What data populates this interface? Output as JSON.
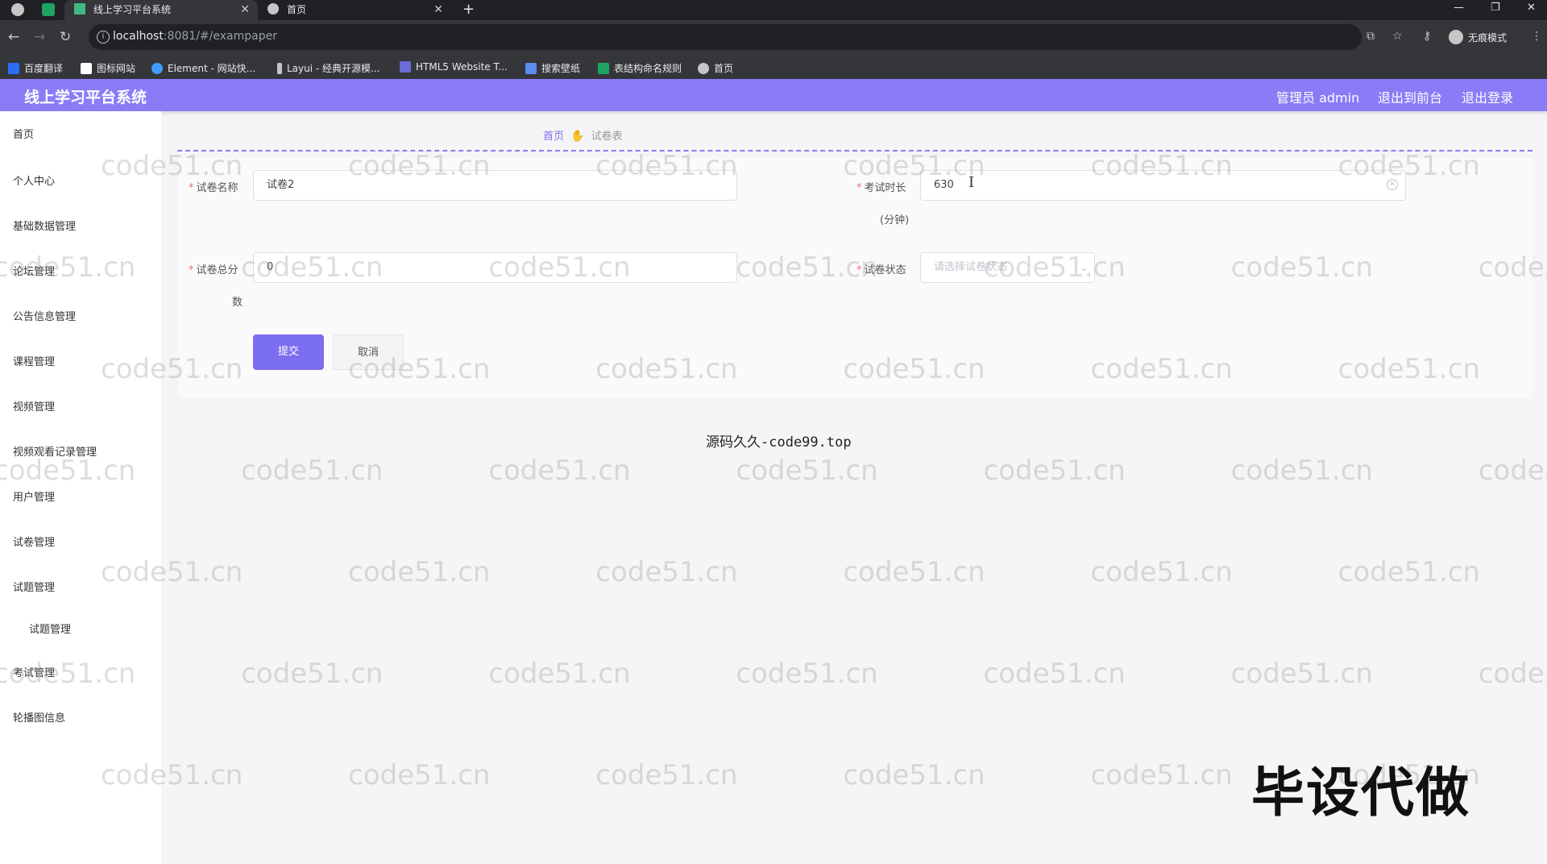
{
  "browser": {
    "tabs": [
      {
        "title": "线上学习平台系统",
        "active": true
      },
      {
        "title": "首页",
        "active": false
      }
    ],
    "new_tab": "+",
    "window_controls": [
      "—",
      "❐",
      "✕"
    ],
    "url_host": "localhost",
    "url_rest": ":8081/#/exampaper",
    "incognito_label": "无痕模式",
    "bookmarks": [
      {
        "label": "百度翻译",
        "color": "#2b6ef5"
      },
      {
        "label": "图标网站",
        "color": "#ffffff"
      },
      {
        "label": "Element - 网站快...",
        "color": "#409eff"
      },
      {
        "label": "Layui - 经典开源模...",
        "color": "#c4c7c5"
      },
      {
        "label": "HTML5 Website T...",
        "color": "#6b6bd6"
      },
      {
        "label": "搜索壁纸",
        "color": "#5b8def"
      },
      {
        "label": "表结构命名规则",
        "color": "#1fa463"
      },
      {
        "label": "首页",
        "color": "#c4c7c5"
      }
    ]
  },
  "app": {
    "title": "线上学习平台系统",
    "admin_label": "管理员 admin",
    "to_front_label": "退出到前台",
    "logout_label": "退出登录",
    "accent_color": "#8a7cf6"
  },
  "sidebar": {
    "items": [
      {
        "label": "首页",
        "sub": false
      },
      {
        "label": "个人中心",
        "sub": false
      },
      {
        "label": "基础数据管理",
        "sub": false
      },
      {
        "label": "论坛管理",
        "sub": false
      },
      {
        "label": "公告信息管理",
        "sub": false
      },
      {
        "label": "课程管理",
        "sub": false
      },
      {
        "label": "视频管理",
        "sub": false
      },
      {
        "label": "视频观看记录管理",
        "sub": false
      },
      {
        "label": "用户管理",
        "sub": false
      },
      {
        "label": "试卷管理",
        "sub": false
      },
      {
        "label": "试题管理",
        "sub": false
      },
      {
        "label": "试题管理",
        "sub": true
      },
      {
        "label": "考试管理",
        "sub": false
      },
      {
        "label": "轮播图信息",
        "sub": false
      }
    ]
  },
  "breadcrumb": {
    "home": "首页",
    "current": "试卷表"
  },
  "form": {
    "name_label": "试卷名称",
    "name_value": "试卷2",
    "duration_label": "考试时长",
    "duration_unit": "(分钟)",
    "duration_value": "630",
    "score_label": "试卷总分",
    "score_unit": "数",
    "score_value": "0",
    "status_label": "试卷状态",
    "status_placeholder": "请选择试卷状态",
    "submit_label": "提交",
    "cancel_label": "取消"
  },
  "overlay": {
    "watermark": "code51.cn",
    "center_note": "源码久久-code99.top",
    "corner_text": "毕设代做"
  }
}
